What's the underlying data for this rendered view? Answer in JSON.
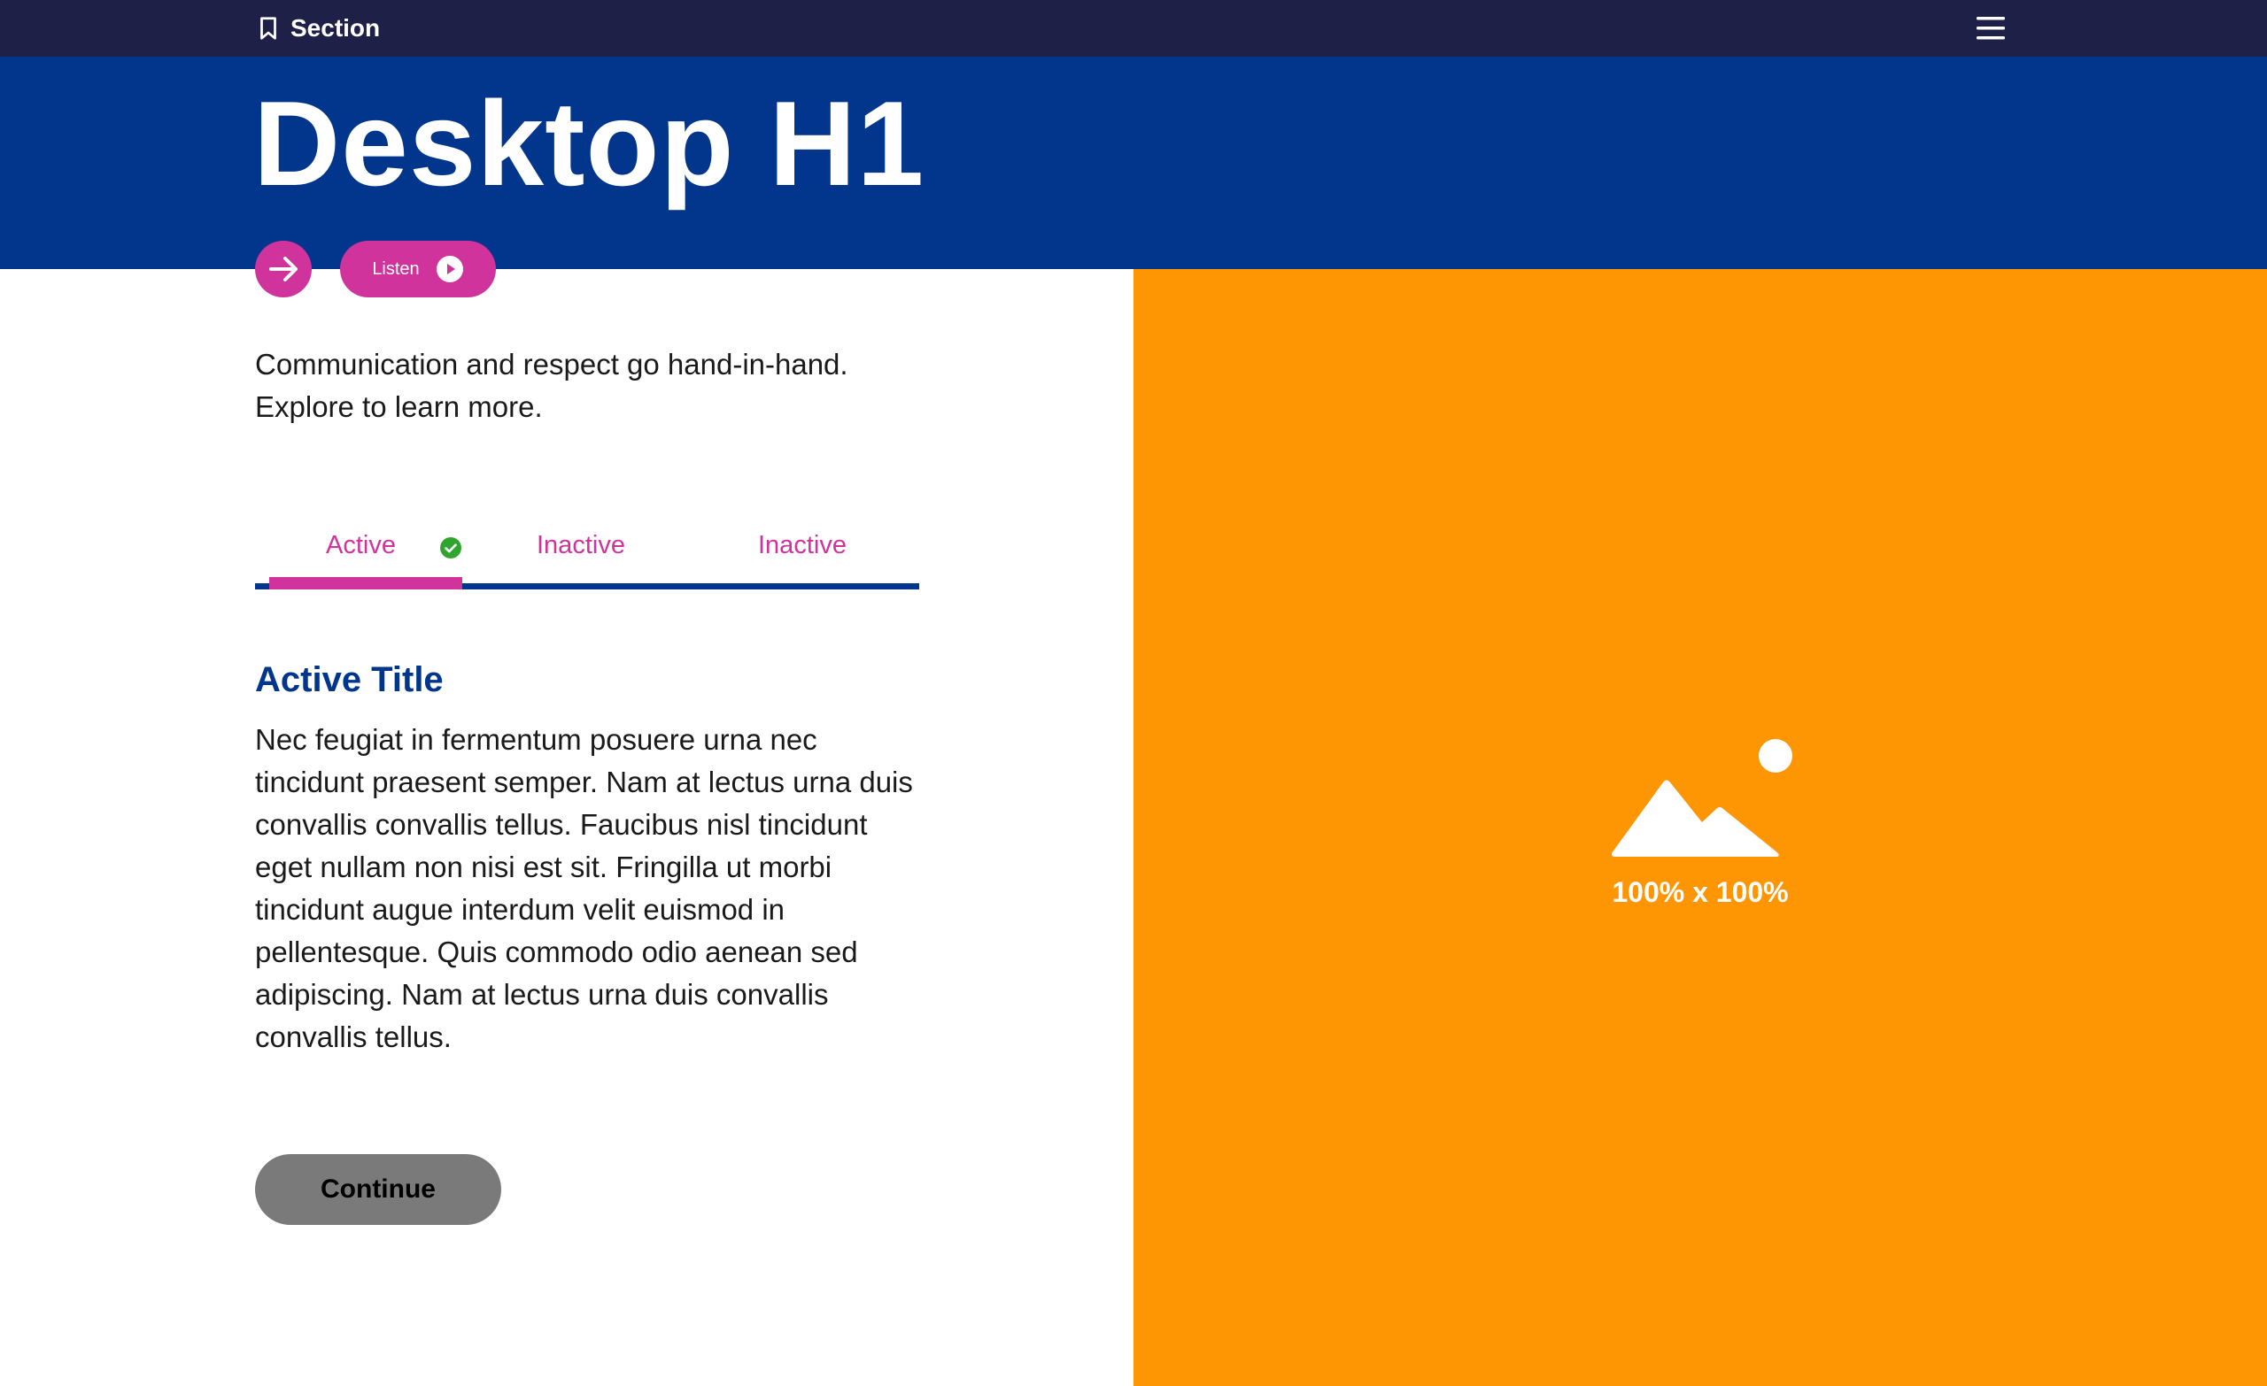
{
  "nav": {
    "section_label": "Section",
    "bookmark_icon": "bookmark-icon",
    "menu_icon": "hamburger-menu-icon"
  },
  "hero": {
    "title": "Desktop H1"
  },
  "actions": {
    "arrow_icon": "arrow-right-icon",
    "listen_label": "Listen",
    "play_icon": "play-icon"
  },
  "intro": {
    "text": "Communication and respect go hand-in-hand. Explore to learn more."
  },
  "tabs": {
    "items": [
      {
        "label": "Active",
        "state": "active",
        "icon": "check-circle-icon"
      },
      {
        "label": "Inactive",
        "state": "inactive"
      },
      {
        "label": "Inactive",
        "state": "inactive"
      }
    ]
  },
  "content": {
    "title": "Active Title",
    "body": "Nec feugiat in fermentum posuere urna nec tincidunt praesent semper. Nam at lectus urna duis convallis convallis tellus. Faucibus nisl tincidunt eget nullam non nisi est sit. Fringilla ut morbi tincidunt augue interdum velit euismod in pellentesque. Quis commodo odio aenean sed adipiscing. Nam at lectus urna duis convallis convallis tellus.",
    "continue_label": "Continue"
  },
  "image": {
    "icon": "image-placeholder-icon",
    "caption": "100% x 100%"
  },
  "colors": {
    "topbar": "#1f2048",
    "hero": "#02368c",
    "accent": "#d0339c",
    "image_panel": "#fe9503",
    "check": "#2fa52f",
    "button_disabled": "#7a7a7a"
  }
}
